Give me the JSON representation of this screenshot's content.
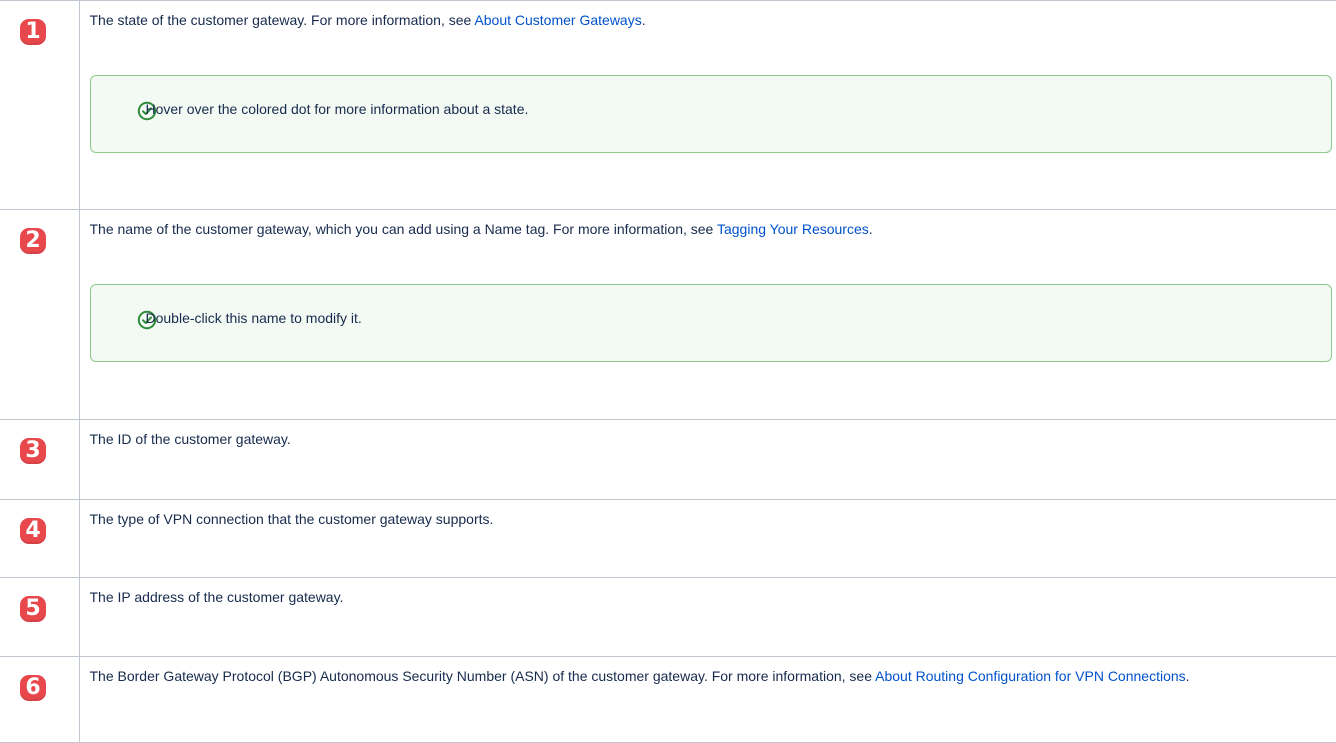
{
  "rows": [
    {
      "number": "1",
      "text_before": "The state of the customer gateway. For more information, see ",
      "link": "About Customer Gateways",
      "text_after": ".",
      "tip": "Hover over the colored dot for more information about a state."
    },
    {
      "number": "2",
      "text_before": "The name of the customer gateway, which you can add using a Name tag. For more information, see ",
      "link": "Tagging Your Resources",
      "text_after": ".",
      "tip": "Double-click this name to modify it."
    },
    {
      "number": "3",
      "text": "The ID of the customer gateway."
    },
    {
      "number": "4",
      "text": "The type of VPN connection that the customer gateway supports."
    },
    {
      "number": "5",
      "text": "The IP address of the customer gateway."
    },
    {
      "number": "6",
      "text_before": "The Border Gateway Protocol (BGP) Autonomous Security Number (ASN) of the customer gateway. For more information, see ",
      "link": "About Routing Configuration for VPN Connections",
      "text_after": "."
    }
  ],
  "colors": {
    "badge": "#e8474c",
    "link": "#0052cc",
    "tip_border": "#8fc98c",
    "tip_background": "#f3f9f3",
    "tip_icon": "#2e8b3a",
    "table_border": "#c1c7d0"
  },
  "icons": {
    "tip": "check-circle-icon"
  }
}
